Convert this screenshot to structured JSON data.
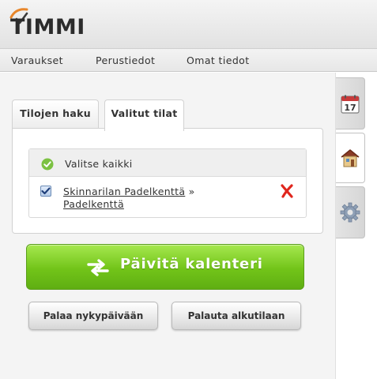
{
  "app": {
    "logo_text": "TIMMI"
  },
  "menu": {
    "items": [
      "Varaukset",
      "Perustiedot",
      "Omat tiedot"
    ]
  },
  "tabs": [
    {
      "label": "Tilojen haku",
      "active": false
    },
    {
      "label": "Valitut tilat",
      "active": true
    }
  ],
  "selected": {
    "select_all_label": "Valitse kaikki",
    "items": [
      {
        "name": "Skinnarilan Padelkenttä",
        "separator": "»",
        "sub": "Padelkenttä",
        "checked": true
      }
    ]
  },
  "buttons": {
    "update": "Päivitä kalenteri",
    "today": "Palaa nykypäivään",
    "reset": "Palauta alkutilaan"
  },
  "sidebar": {
    "calendar_day": "17",
    "tabs": [
      "calendar-icon",
      "house-icon",
      "gear-icon"
    ]
  },
  "colors": {
    "update_button": "#72c419",
    "remove_icon": "#e0261d",
    "logo_accent": "#e8862a",
    "check_green": "#7cc142"
  }
}
